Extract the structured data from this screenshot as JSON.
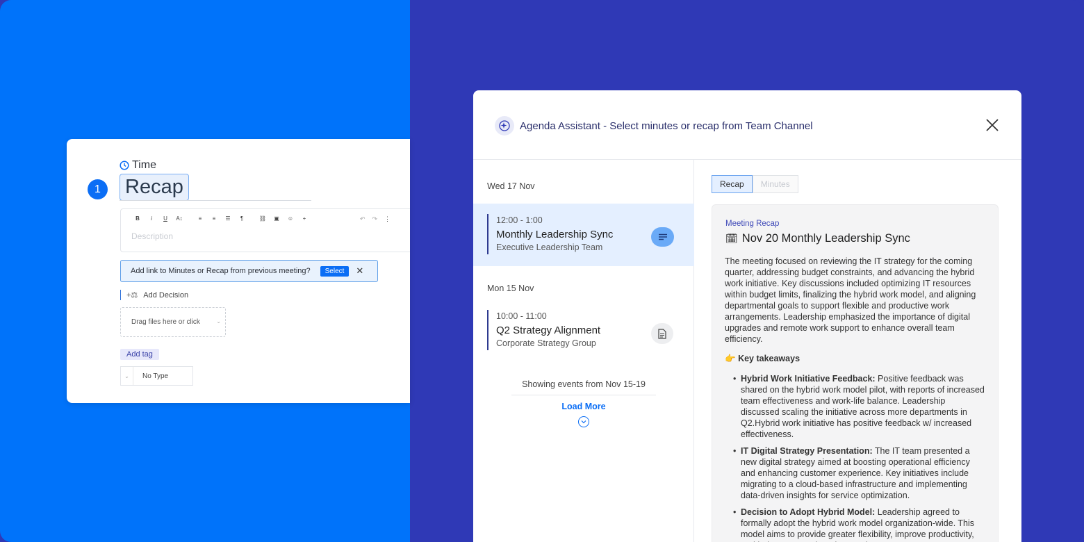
{
  "editor": {
    "step_number": "1",
    "time_label": "Time",
    "title": "Recap",
    "toolbar_items": [
      "B",
      "i",
      "U",
      "A↕",
      "≡",
      "≡",
      "☰",
      "¶",
      "⛓",
      "▣",
      "☺",
      "+"
    ],
    "description_placeholder": "Description",
    "link_prompt": "Add link to Minutes or Recap from previous meeting?",
    "select_label": "Select",
    "add_decision": "Add Decision",
    "drop_zone": "Drag files here or click",
    "add_tag": "Add tag",
    "type_value": "No Type"
  },
  "modal": {
    "title": "Agenda Assistant - Select minutes or recap from Team Channel",
    "groups": [
      {
        "date": "Wed 17 Nov",
        "event": {
          "time": "12:00 - 1:00",
          "title": "Monthly Leadership Sync",
          "subtitle": "Executive Leadership Team",
          "icon": "recap-lines-icon"
        }
      },
      {
        "date": "Mon 15 Nov",
        "event": {
          "time": "10:00 - 11:00",
          "title": "Q2 Strategy Alignment",
          "subtitle": "Corporate Strategy Group",
          "icon": "document-icon"
        }
      }
    ],
    "showing": "Showing events from Nov 15-19",
    "load_more": "Load More",
    "tabs": [
      "Recap",
      "Minutes"
    ],
    "recap": {
      "label": "Meeting Recap",
      "title": "Nov 20 Monthly Leadership Sync",
      "paragraph": "The meeting focused on reviewing the IT strategy for the coming quarter, addressing budget constraints, and advancing the hybrid work initiative. Key discussions included optimizing IT resources within budget limits, finalizing the hybrid work model, and aligning departmental goals to support flexible and productive work arrangements. Leadership emphasized the importance of digital upgrades and remote work support to enhance overall team efficiency.",
      "takeaways_heading": "Key takeaways",
      "takeaways": [
        {
          "title": "Hybrid Work Initiative Feedback:",
          "text": " Positive feedback was shared on the hybrid work model pilot, with reports of increased team effectiveness and work-life balance. Leadership discussed scaling the initiative across more departments in Q2.Hybrid work initiative has positive feedback w/ increased effectiveness."
        },
        {
          "title": "IT Digital Strategy Presentation:",
          "text": " The IT team presented a new digital strategy aimed at boosting operational efficiency and enhancing customer experience. Key initiatives include migrating to a cloud-based infrastructure and implementing data-driven insights for service optimization."
        },
        {
          "title": "Decision to Adopt Hybrid Model:",
          "text": " Leadership agreed to formally adopt the hybrid work model organization-wide. This model aims to provide greater flexibility, improve productivity, and help attract and retain top talent."
        }
      ]
    }
  },
  "colors": {
    "left_bg": "#0073fa",
    "right_bg": "#2f39b6",
    "accent": "#0b6ef5",
    "active_event": "#e4efff"
  }
}
